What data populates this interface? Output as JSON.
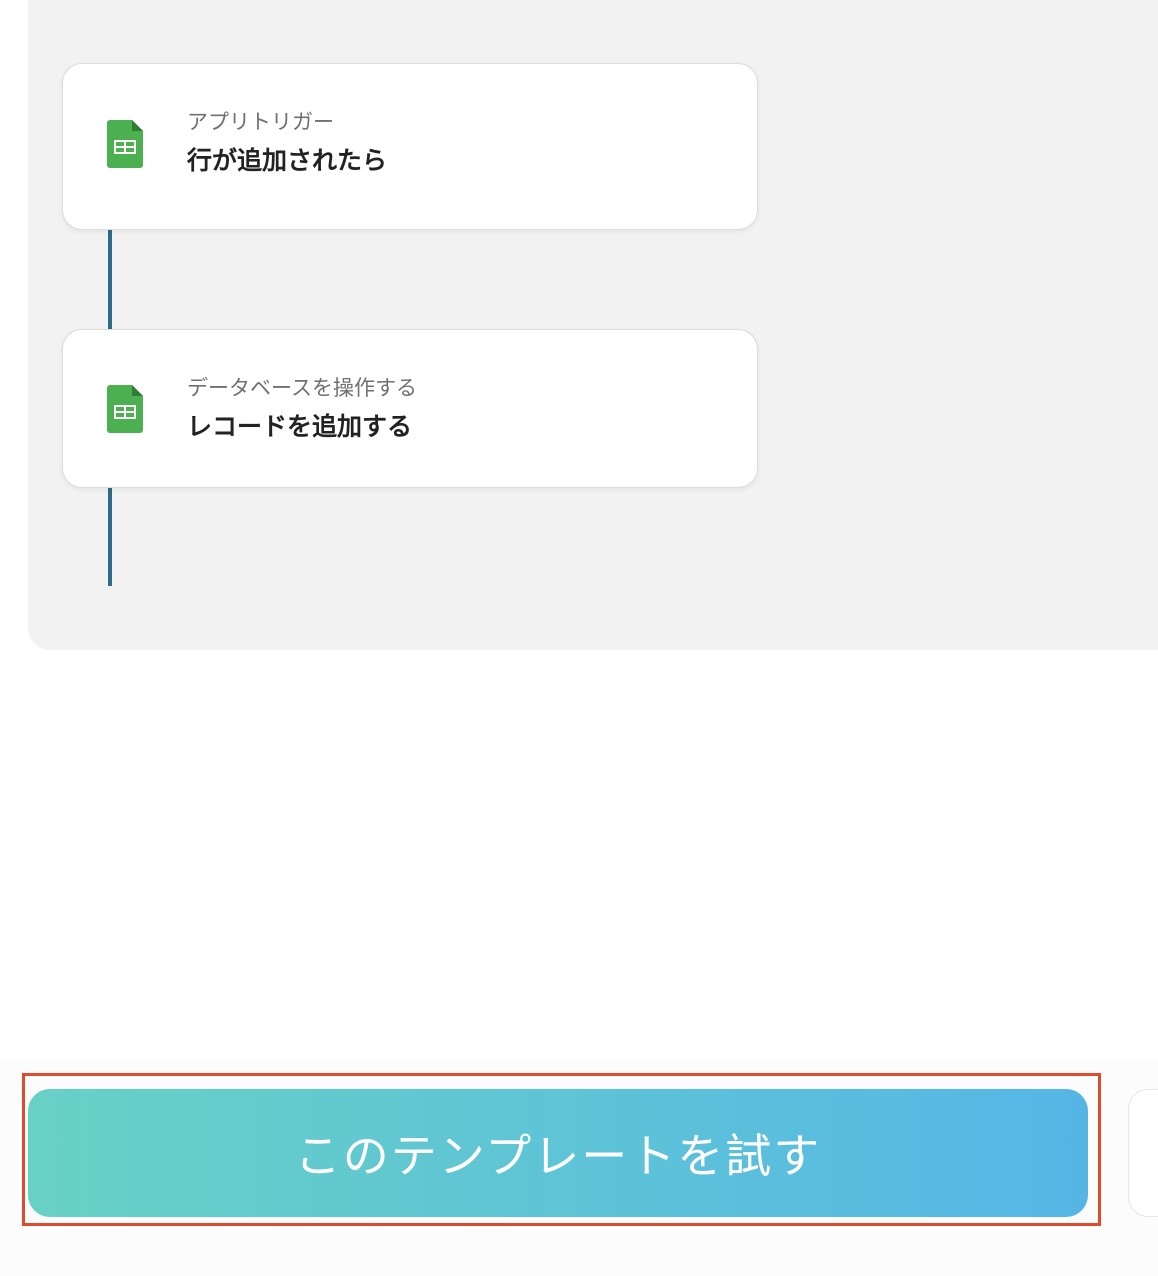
{
  "flow": {
    "steps": [
      {
        "icon": "google-sheets-icon",
        "subtitle": "アプリトリガー",
        "title": "行が追加されたら"
      },
      {
        "icon": "google-sheets-icon",
        "subtitle": "データベースを操作する",
        "title": "レコードを追加する"
      }
    ]
  },
  "cta": {
    "label": "このテンプレートを試す"
  },
  "colors": {
    "connector": "#2f6a8a",
    "sheets_green": "#4caf50",
    "button_gradient_start": "#68d1c5",
    "button_gradient_end": "#55b6e6",
    "highlight": "#e04a2f"
  }
}
